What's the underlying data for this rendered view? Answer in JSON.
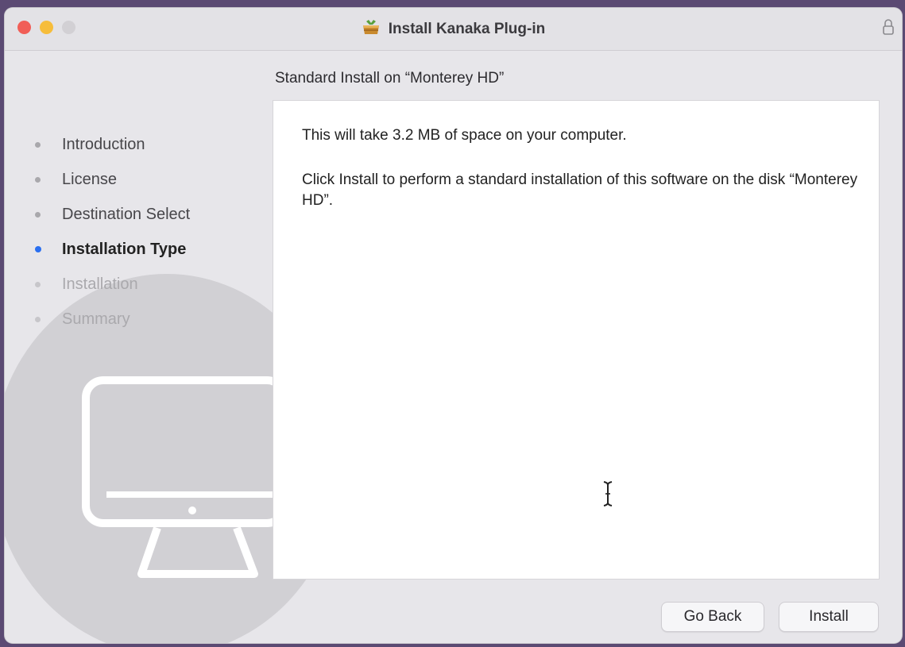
{
  "window": {
    "title": "Install Kanaka Plug-in",
    "title_icon": "package-box-icon"
  },
  "sidebar": {
    "steps": [
      {
        "label": "Introduction",
        "state": "done"
      },
      {
        "label": "License",
        "state": "done"
      },
      {
        "label": "Destination Select",
        "state": "done"
      },
      {
        "label": "Installation Type",
        "state": "current"
      },
      {
        "label": "Installation",
        "state": "pending"
      },
      {
        "label": "Summary",
        "state": "pending"
      }
    ],
    "background_icon": "monitor-icon"
  },
  "main": {
    "heading": "Standard Install on “Monterey HD”",
    "message_space": "This will take 3.2 MB of space on your computer.",
    "message_instructions": "Click Install to perform a standard installation of this software on the disk “Monterey HD”."
  },
  "footer": {
    "go_back_label": "Go Back",
    "install_label": "Install"
  },
  "colors": {
    "current_step_dot": "#2a6ff0",
    "close": "#f15e57",
    "minimize": "#f6bd3b",
    "zoom_disabled": "#d2d0d4"
  }
}
